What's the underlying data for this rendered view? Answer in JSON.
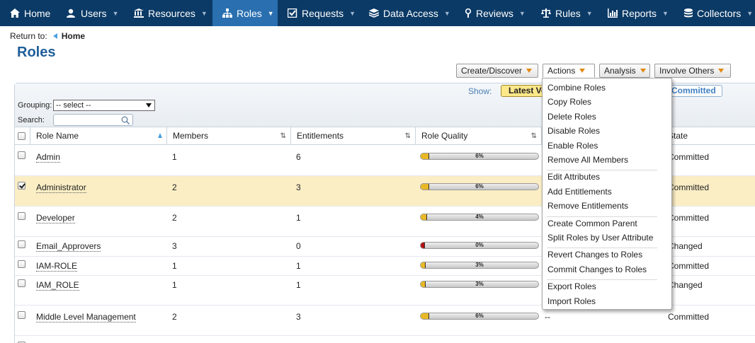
{
  "nav": {
    "items": [
      {
        "label": "Home",
        "icon": "home-icon"
      },
      {
        "label": "Users",
        "icon": "users-icon"
      },
      {
        "label": "Resources",
        "icon": "resources-icon"
      },
      {
        "label": "Roles",
        "icon": "roles-icon",
        "active": true
      },
      {
        "label": "Requests",
        "icon": "requests-icon"
      },
      {
        "label": "Data Access",
        "icon": "data-access-icon"
      },
      {
        "label": "Reviews",
        "icon": "reviews-icon"
      },
      {
        "label": "Rules",
        "icon": "rules-icon"
      },
      {
        "label": "Reports",
        "icon": "reports-icon"
      },
      {
        "label": "Collectors",
        "icon": "collectors-icon"
      }
    ],
    "background": "#0b3a66",
    "active_color": "#2a70b0"
  },
  "breadcrumb": {
    "prefix": "Return to:",
    "home": "Home"
  },
  "page": {
    "title": "Roles"
  },
  "toolbar": {
    "create_discover": "Create/Discover",
    "actions": "Actions",
    "analysis": "Analysis",
    "involve_others": "Involve Others"
  },
  "grid": {
    "show_label": "Show:",
    "latest_label": "Latest Version",
    "committed_label": "Committed",
    "grouping_label": "Grouping:",
    "grouping_value": "-- select --",
    "search_label": "Search:",
    "search_value": "",
    "columns": {
      "role_name": "Role Name",
      "members": "Members",
      "entitlements": "Entitlements",
      "role_quality": "Role Quality",
      "state": "State"
    },
    "rows": [
      {
        "name": "Admin",
        "members": "1",
        "entitlements": "6",
        "quality": "6%",
        "quality_value": 0.06,
        "extra": "",
        "state": "Committed",
        "selected": false
      },
      {
        "name": "Administrator",
        "members": "2",
        "entitlements": "3",
        "quality": "6%",
        "quality_value": 0.06,
        "extra": "",
        "state": "Committed",
        "selected": true
      },
      {
        "name": "Developer",
        "members": "2",
        "entitlements": "1",
        "quality": "4%",
        "quality_value": 0.04,
        "extra": "",
        "state": "Committed",
        "selected": false
      },
      {
        "name": "Email_Approvers",
        "members": "3",
        "entitlements": "0",
        "quality": "0%",
        "quality_value": 0.0,
        "extra": "",
        "state": "Changed",
        "selected": false
      },
      {
        "name": "IAM-ROLE",
        "members": "1",
        "entitlements": "1",
        "quality": "3%",
        "quality_value": 0.03,
        "extra": "",
        "state": "Committed",
        "selected": false
      },
      {
        "name": "IAM_ROLE",
        "members": "1",
        "entitlements": "1",
        "quality": "3%",
        "quality_value": 0.03,
        "extra": "",
        "state": "Changed",
        "selected": false
      },
      {
        "name": "Middle Level Management",
        "members": "2",
        "entitlements": "3",
        "quality": "6%",
        "quality_value": 0.06,
        "extra": "--",
        "state": "Committed",
        "selected": false
      }
    ]
  },
  "actions_menu": {
    "groups": [
      [
        "Combine Roles",
        "Copy Roles",
        "Delete Roles",
        "Disable Roles",
        "Enable Roles",
        "Remove All Members"
      ],
      [
        "Edit Attributes",
        "Add Entitlements",
        "Remove Entitlements"
      ],
      [
        "Create Common Parent",
        "Split Roles by User Attribute"
      ],
      [
        "Revert Changes to Roles",
        "Commit Changes to Roles"
      ],
      [
        "Export Roles",
        "Import Roles"
      ]
    ]
  }
}
